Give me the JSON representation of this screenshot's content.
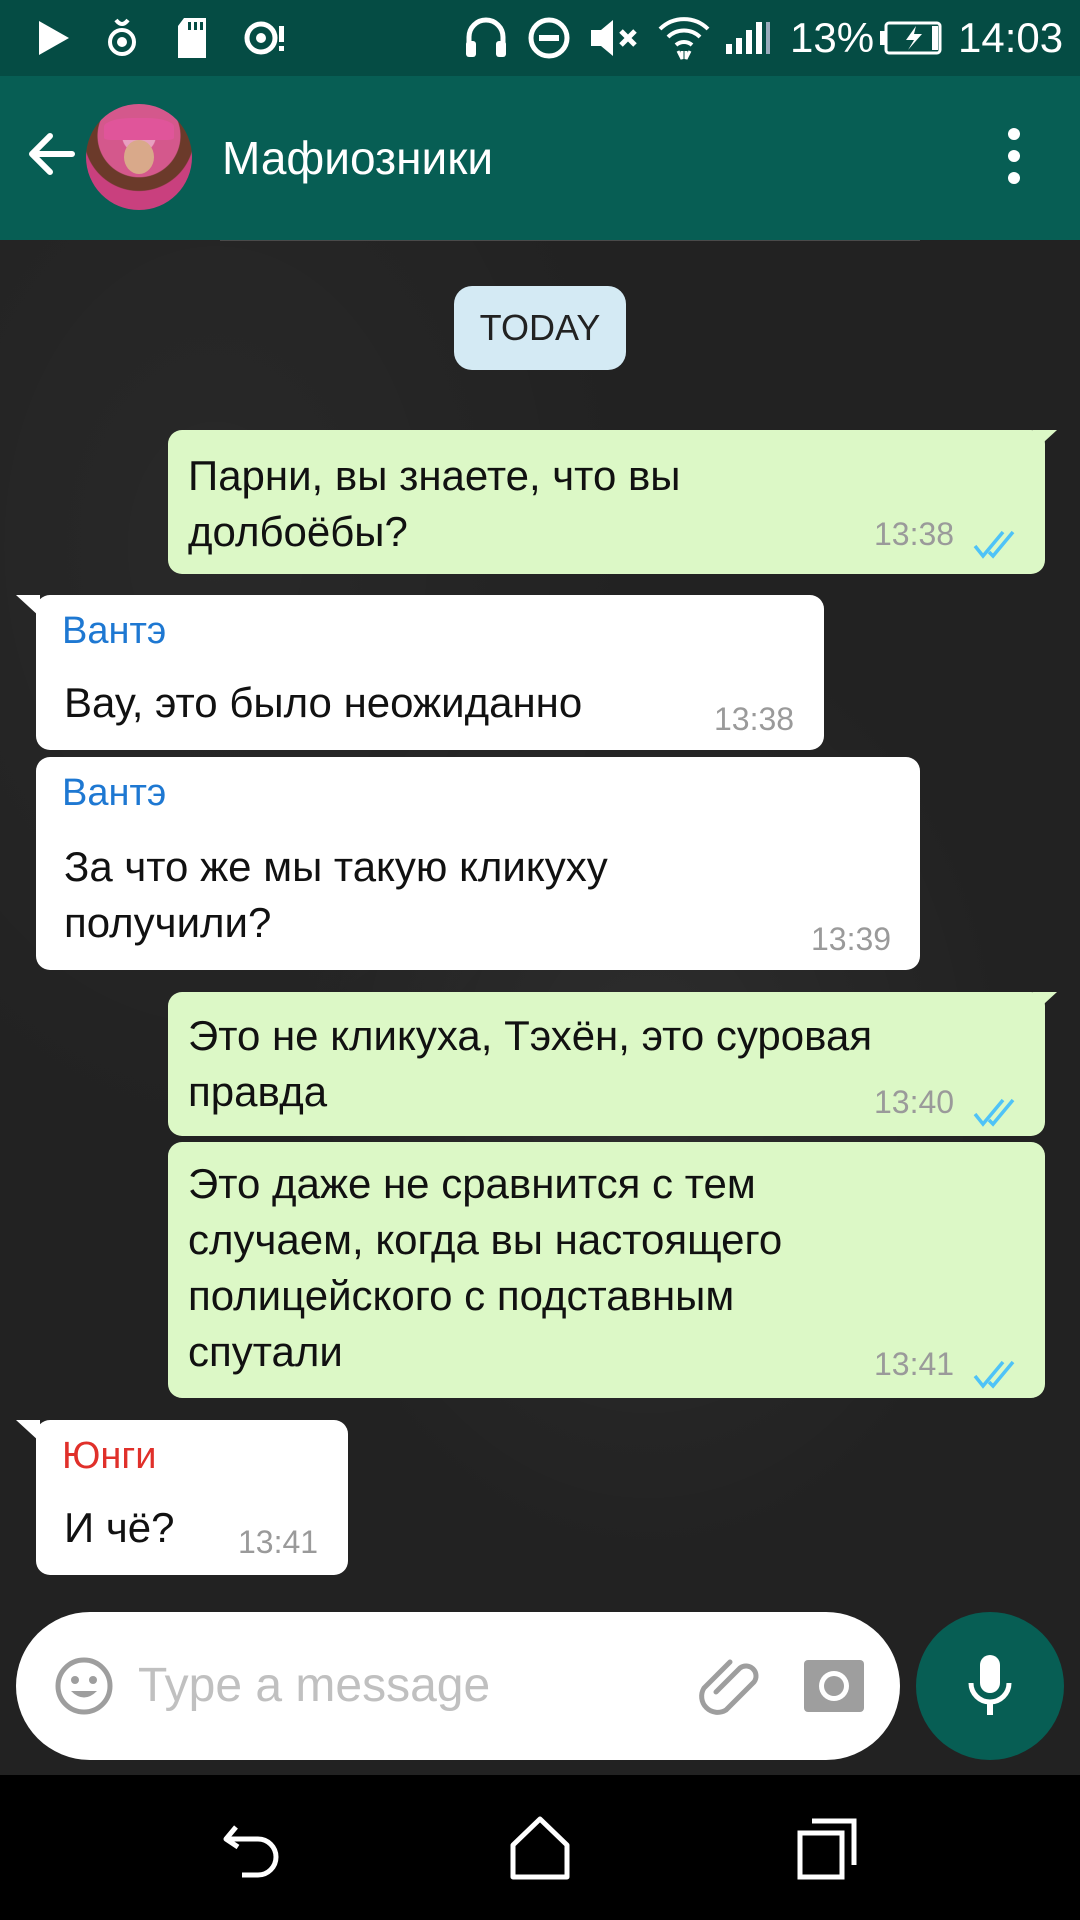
{
  "status_bar": {
    "battery": "13%",
    "time": "14:03",
    "icons": [
      "play-icon",
      "hotspot-icon",
      "sd-card-icon",
      "sync-icon",
      "headphones-icon",
      "do-not-disturb-icon",
      "mute-icon",
      "wifi-icon",
      "signal-icon",
      "battery-icon"
    ]
  },
  "header": {
    "title": "Мафиозники",
    "back_icon": "arrow-back-icon",
    "menu_icon": "more-vert-icon"
  },
  "chat": {
    "date_label": "TODAY",
    "messages": [
      {
        "direction": "out",
        "lines": [
          "Парни, вы знаете, что вы",
          "долбоёбы?"
        ],
        "time": "13:38",
        "status": "read"
      },
      {
        "direction": "in",
        "sender": "Вантэ",
        "sender_color": "#1e78d2",
        "lines": [
          "Вау, это было неожиданно"
        ],
        "time": "13:38"
      },
      {
        "direction": "in",
        "sender": "Вантэ",
        "sender_color": "#1e78d2",
        "lines": [
          "За что же мы такую кликуху",
          "получили?"
        ],
        "time": "13:39"
      },
      {
        "direction": "out",
        "lines": [
          "Это не кликуха, Тэхён, это суровая",
          "правда"
        ],
        "time": "13:40",
        "status": "read"
      },
      {
        "direction": "out",
        "lines": [
          "Это даже не сравнится с тем",
          "случаем, когда вы настоящего",
          "полицейского с подставным",
          "спутали"
        ],
        "time": "13:41",
        "status": "read"
      },
      {
        "direction": "in",
        "sender": "Юнги",
        "sender_color": "#e0302a",
        "lines": [
          "И чё?"
        ],
        "time": "13:41"
      }
    ]
  },
  "composer": {
    "placeholder": "Type a message",
    "emoji_icon": "emoji-icon",
    "attach_icon": "paperclip-icon",
    "camera_icon": "camera-icon",
    "mic_icon": "mic-icon"
  },
  "colors": {
    "header": "#075e54",
    "status_bar": "#054c44",
    "outgoing_bubble": "#dcf8c6",
    "incoming_bubble": "#ffffff",
    "read_ticks": "#4fc3f7"
  },
  "nav": {
    "icons": [
      "back-nav-icon",
      "home-nav-icon",
      "recents-nav-icon"
    ]
  }
}
